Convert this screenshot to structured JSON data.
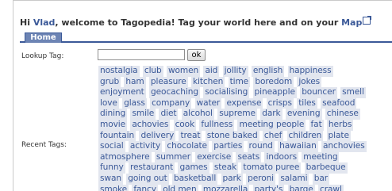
{
  "welcome": {
    "prefix": "Hi ",
    "user": "Vlad",
    "middle": ", welcome to Tagopedia! Tag your world here and on your ",
    "map_link": "Map"
  },
  "tabs": [
    {
      "label": "Home"
    }
  ],
  "lookup": {
    "label": "Lookup Tag:",
    "input_value": "",
    "button_label": "ok"
  },
  "recent": {
    "label": "Recent Tags:",
    "rows": [
      [
        "nostalgia",
        "club",
        "women",
        "aid",
        "jollity",
        "english",
        "happiness"
      ],
      [
        "grub",
        "ham",
        "pleasure",
        "kitchen",
        "time",
        "boredom",
        "jokes"
      ],
      [
        "enjoyment",
        "geocaching",
        "socialising",
        "pineapple",
        "bouncer",
        "smell"
      ],
      [
        "love",
        "glass",
        "company",
        "water",
        "expense",
        "crisps",
        "tiles",
        "seafood"
      ],
      [
        "dining",
        "smile",
        "diet",
        "alcohol",
        "supreme",
        "dark",
        "evening",
        "chinese"
      ],
      [
        "movie",
        "achovies",
        "cook",
        "fullness",
        "meeting people",
        "fat",
        "herbs"
      ],
      [
        "fountain",
        "delivery",
        "treat",
        "stone baked",
        "chef",
        "children",
        "plate"
      ],
      [
        "social",
        "activity",
        "chocolate",
        "parties",
        "round",
        "hawaiian",
        "anchovies"
      ],
      [
        "atmosphere",
        "summer",
        "exercise",
        "seats",
        "indoors",
        "meeting"
      ],
      [
        "funny",
        "restaurant",
        "games",
        "steak",
        "tomato puree",
        "barbeque"
      ],
      [
        "swan",
        "going out",
        "basketball",
        "park",
        "peroni",
        "salami",
        "bar"
      ],
      [
        "smoke",
        "fancy",
        "old men",
        "mozzarella",
        "party's",
        "barge",
        "crawl"
      ]
    ]
  }
}
